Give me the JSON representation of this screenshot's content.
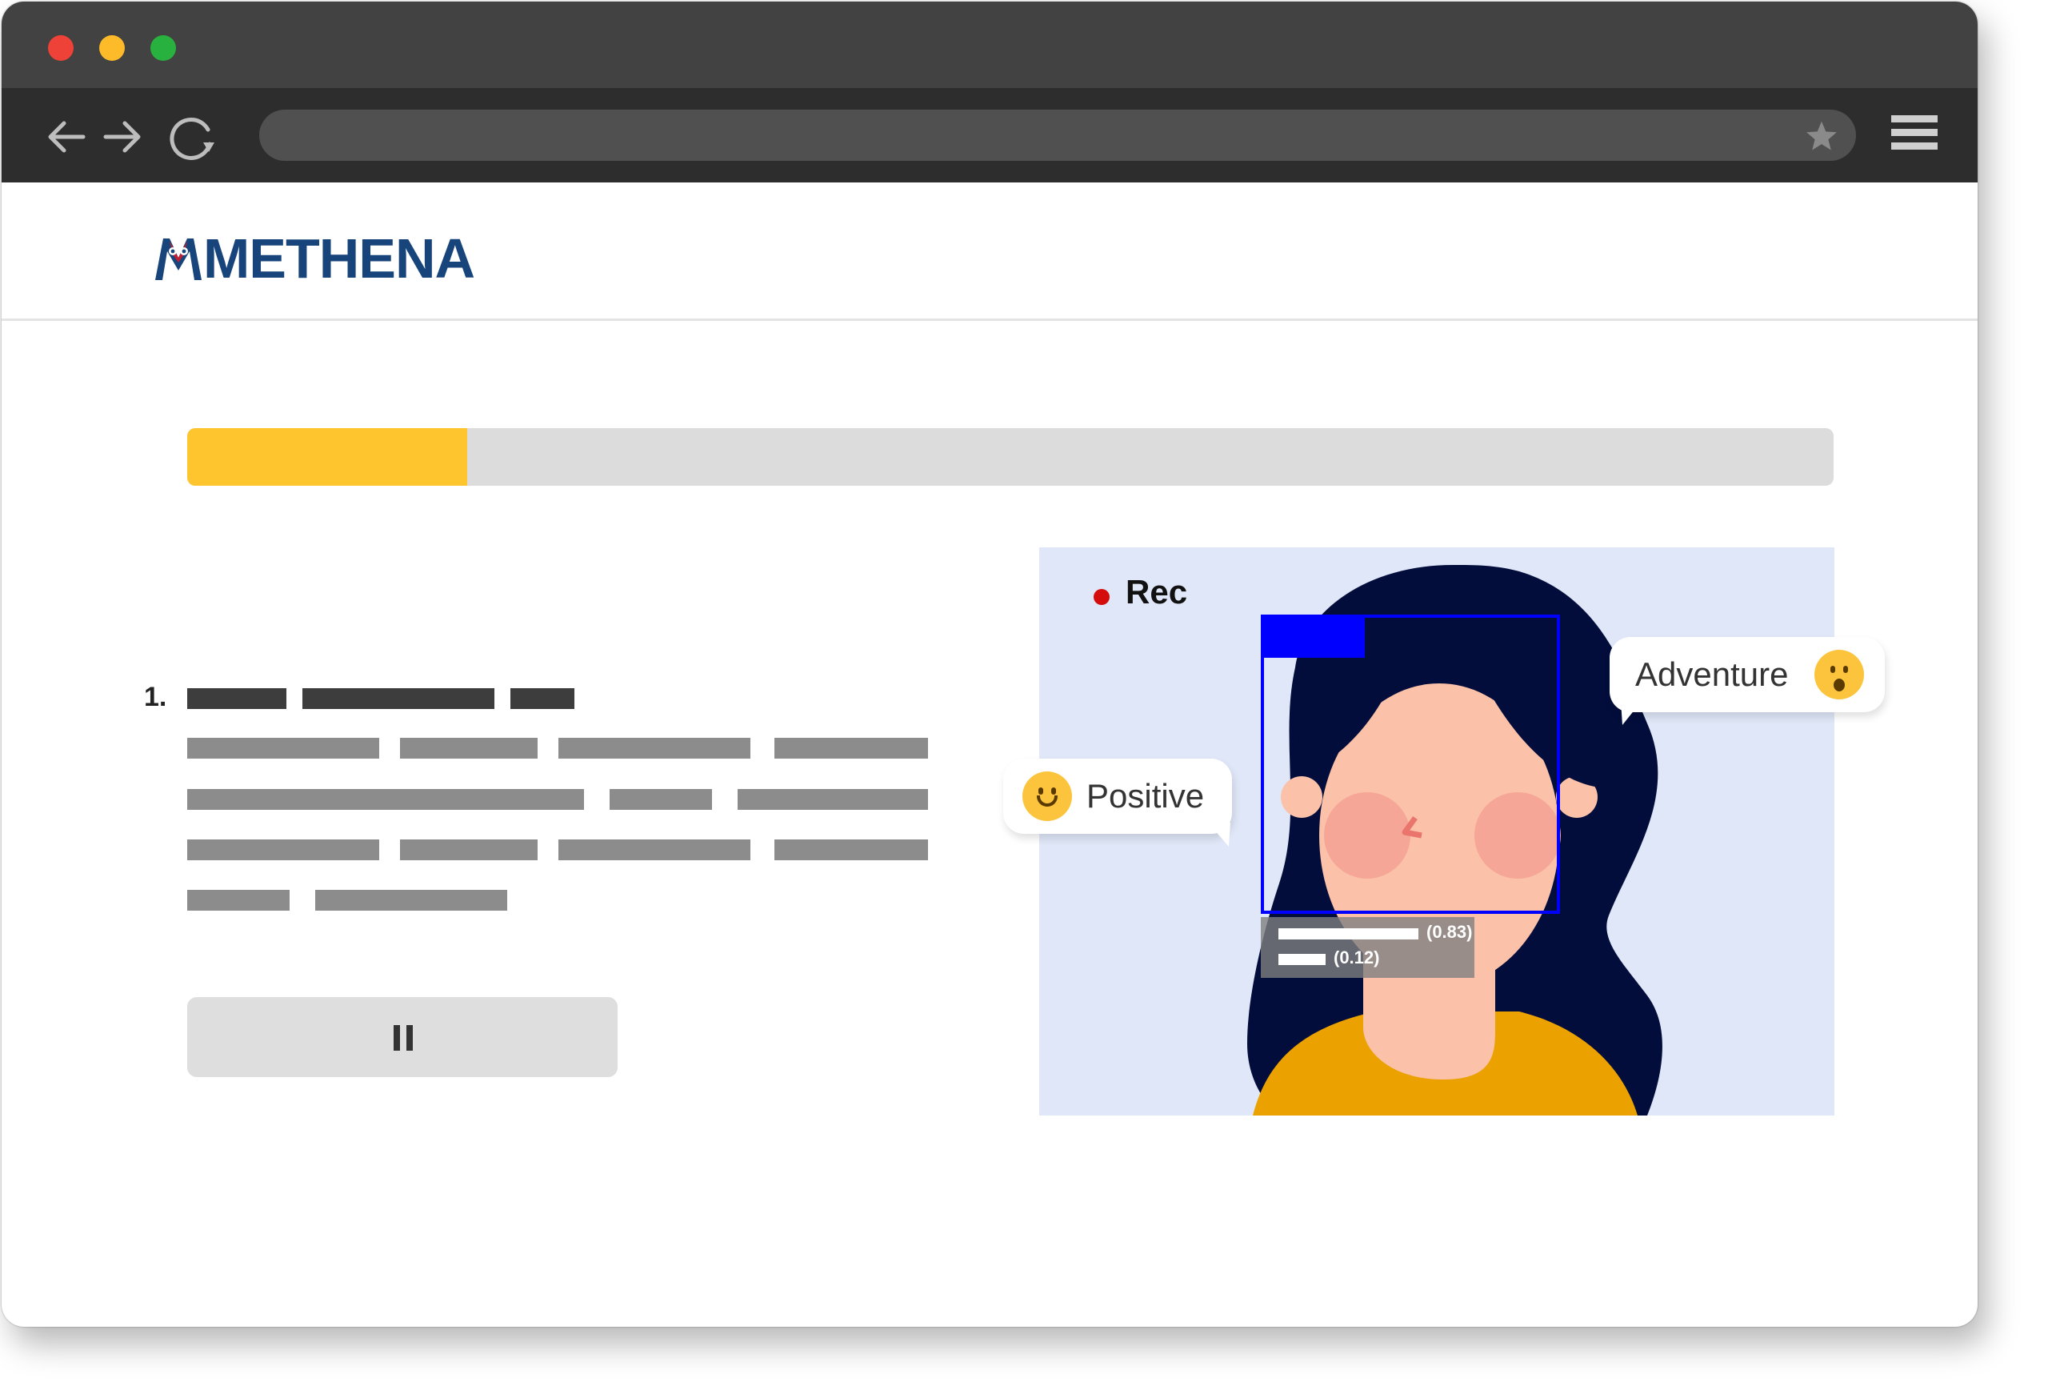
{
  "browser": {
    "url": "",
    "traffic_lights": [
      "#ee4137",
      "#fdbb2a",
      "#28b13e"
    ]
  },
  "brand": {
    "logo_text": "METHENA",
    "colors": {
      "primary": "#17447a",
      "accent": "#c21d33"
    }
  },
  "progress": {
    "value": 0.17,
    "fill_color": "#fec52f",
    "track_color": "#dcdcdc"
  },
  "question": {
    "number": "1."
  },
  "controls": {
    "pause_icon": "pause-icon"
  },
  "video": {
    "rec_label": "Rec",
    "detection": {
      "box_color": "#0000ff",
      "scores": [
        {
          "text": "(0.83)",
          "value": 0.83
        },
        {
          "text": "(0.12)",
          "value": 0.12
        }
      ]
    },
    "emotions": [
      {
        "label": "Adventure",
        "icon": "surprised-face-icon"
      },
      {
        "label": "Positive",
        "icon": "smiling-face-icon"
      }
    ]
  }
}
